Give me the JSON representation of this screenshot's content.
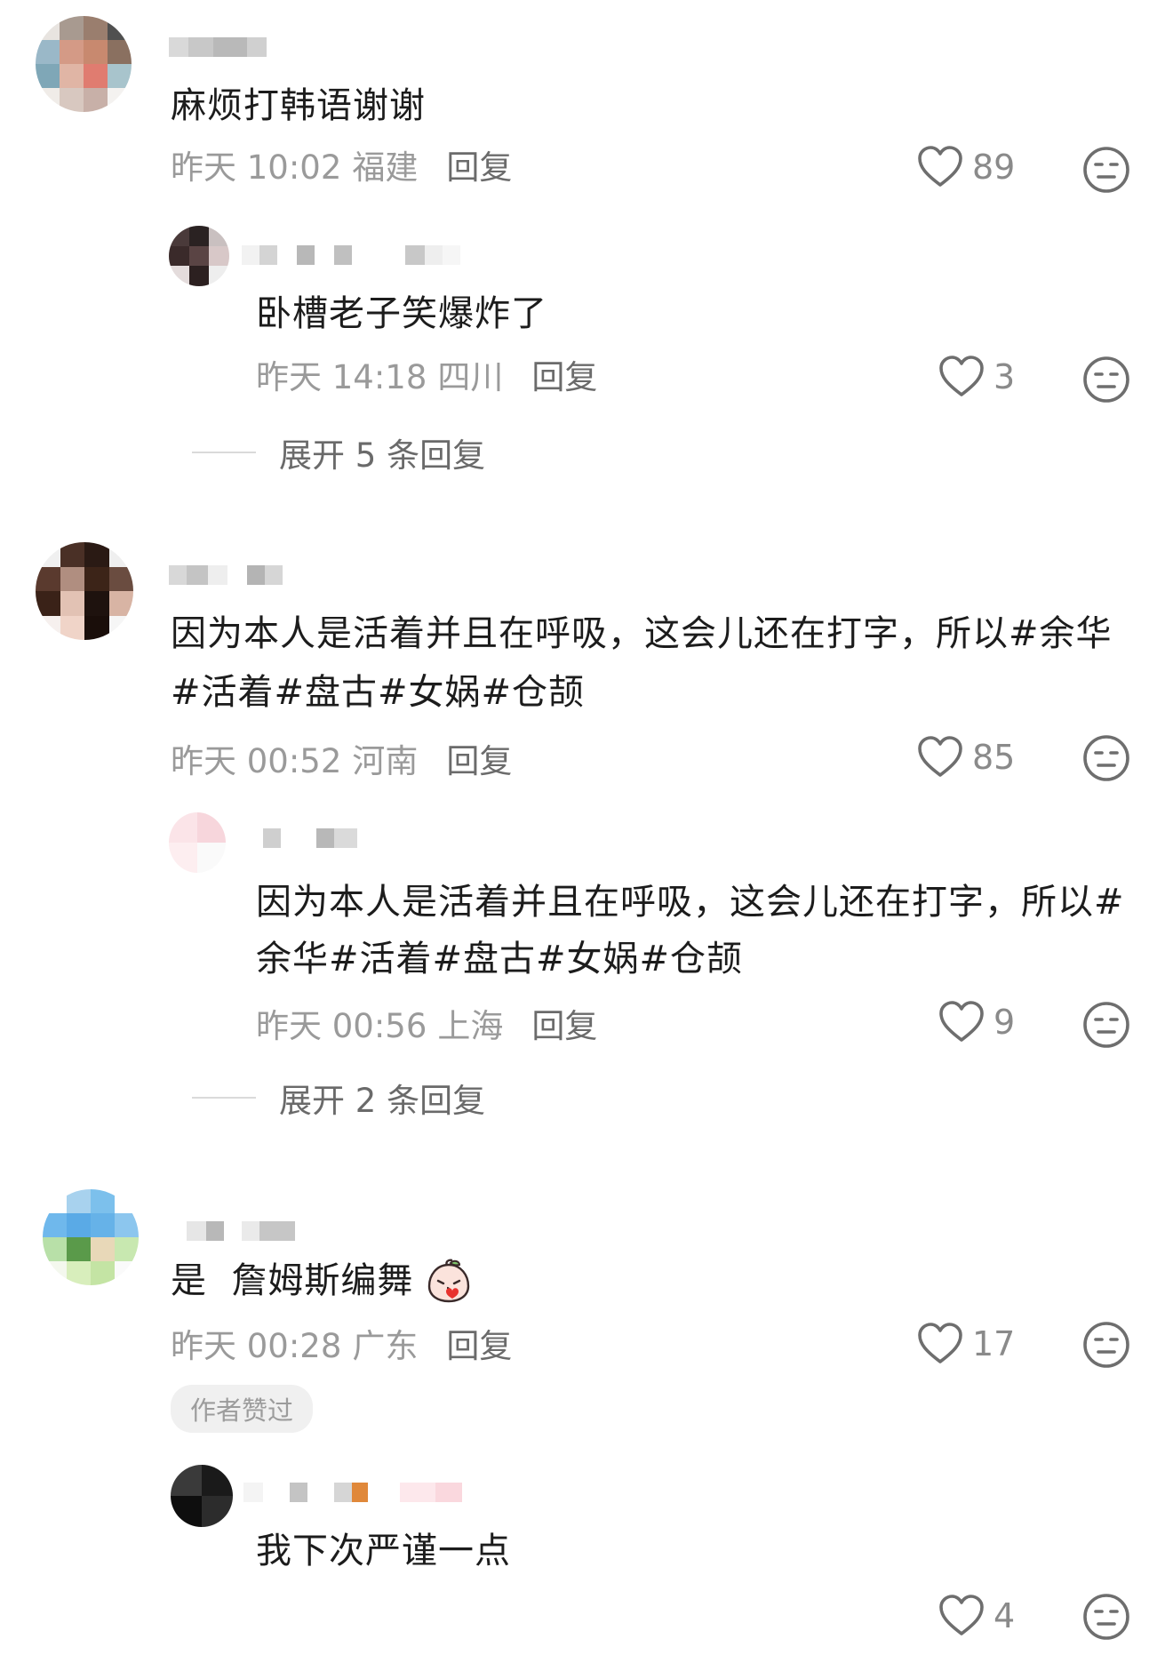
{
  "comments": [
    {
      "text": "麻烦打韩语谢谢",
      "date": "昨天 10:02",
      "location": "福建",
      "reply_label": "回复",
      "likes": "89",
      "replies": [
        {
          "text": "卧槽老子笑爆炸了",
          "date": "昨天 14:18",
          "location": "四川",
          "reply_label": "回复",
          "likes": "3"
        }
      ],
      "expand_label": "展开 5 条回复"
    },
    {
      "text_line1": "因为本人是活着并且在呼吸，这会儿还在打字，所以#余华",
      "text_line2": "#活着#盘古#女娲#仓颉",
      "date": "昨天 00:52",
      "location": "河南",
      "reply_label": "回复",
      "likes": "85",
      "replies": [
        {
          "text_line1": "因为本人是活着并且在呼吸，这会儿还在打字，所以#",
          "text_line2": "余华#活着#盘古#女娲#仓颉",
          "date": "昨天 00:56",
          "location": "上海",
          "reply_label": "回复",
          "likes": "9"
        }
      ],
      "expand_label": "展开 2 条回复"
    },
    {
      "text": "是  詹姆斯编舞",
      "date": "昨天 00:28",
      "location": "广东",
      "reply_label": "回复",
      "likes": "17",
      "author_badge": "作者赞过",
      "replies": [
        {
          "text": "我下次严谨一点",
          "likes": "4"
        }
      ]
    }
  ],
  "icons": {
    "like": "heart-outline-icon",
    "dislike": "neutral-face-icon",
    "emoji": "kissing-peach-emoji"
  },
  "colors": {
    "text": "#1c1c1c",
    "meta": "#9a9a9a",
    "reply": "#6b6b6b",
    "icon": "#6e6e6e"
  }
}
